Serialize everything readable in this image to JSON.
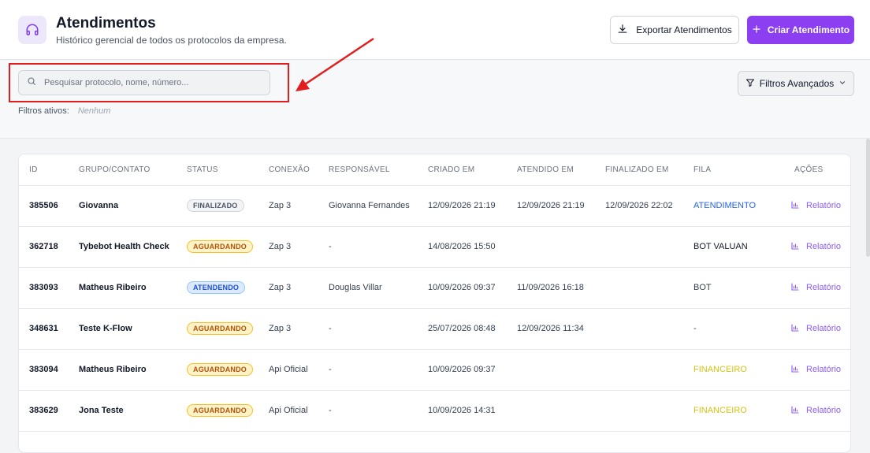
{
  "header": {
    "title": "Atendimentos",
    "subtitle": "Histórico gerencial de todos os protocolos da empresa.",
    "icon": "headset-icon",
    "export_label": "Exportar Atendimentos",
    "create_label": "Criar Atendimento"
  },
  "filters": {
    "search_placeholder": "Pesquisar protocolo, nome, número...",
    "search_value": "",
    "active_label": "Filtros ativos:",
    "active_value": "Nenhum",
    "advanced_label": "Filtros Avançados"
  },
  "colors": {
    "brand": "#8b3ff0",
    "annotation": "#e11d1d"
  },
  "table": {
    "columns": [
      "ID",
      "GRUPO/CONTATO",
      "STATUS",
      "CONEXÃO",
      "RESPONSÁVEL",
      "CRIADO EM",
      "ATENDIDO EM",
      "FINALIZADO EM",
      "FILA",
      "AÇÕES"
    ],
    "rows": [
      {
        "id": "385506",
        "contact": "Giovanna",
        "status": "FINALIZADO",
        "status_kind": "finalizado",
        "connection": "Zap 3",
        "responsible": "Giovanna Fernandes",
        "created": "12/09/2026 21:19",
        "attended": "12/09/2026 21:19",
        "finished": "12/09/2026 22:02",
        "queue": "ATENDIMENTO",
        "queue_color": "#2563eb",
        "action": "Relatório"
      },
      {
        "id": "362718",
        "contact": "Tybebot Health Check",
        "status": "AGUARDANDO",
        "status_kind": "aguardando",
        "connection": "Zap 3",
        "responsible": "-",
        "created": "14/08/2026 15:50",
        "attended": "",
        "finished": "",
        "queue": "BOT VALUAN",
        "queue_color": "#111827",
        "action": "Relatório"
      },
      {
        "id": "383093",
        "contact": "Matheus Ribeiro",
        "status": "ATENDENDO",
        "status_kind": "atendendo",
        "connection": "Zap 3",
        "responsible": "Douglas Villar",
        "created": "10/09/2026 09:37",
        "attended": "11/09/2026 16:18",
        "finished": "",
        "queue": "BOT",
        "queue_color": "#374151",
        "action": "Relatório"
      },
      {
        "id": "348631",
        "contact": "Teste K-Flow",
        "status": "AGUARDANDO",
        "status_kind": "aguardando",
        "connection": "Zap 3",
        "responsible": "-",
        "created": "25/07/2026 08:48",
        "attended": "12/09/2026 11:34",
        "finished": "",
        "queue": "-",
        "queue_color": "#374151",
        "action": "Relatório"
      },
      {
        "id": "383094",
        "contact": "Matheus Ribeiro",
        "status": "AGUARDANDO",
        "status_kind": "aguardando",
        "connection": "Api Oficial",
        "responsible": "-",
        "created": "10/09/2026 09:37",
        "attended": "",
        "finished": "",
        "queue": "FINANCEIRO",
        "queue_color": "#d4c414",
        "action": "Relatório"
      },
      {
        "id": "383629",
        "contact": "Jona Teste",
        "status": "AGUARDANDO",
        "status_kind": "aguardando",
        "connection": "Api Oficial",
        "responsible": "-",
        "created": "10/09/2026 14:31",
        "attended": "",
        "finished": "",
        "queue": "FINANCEIRO",
        "queue_color": "#d4c414",
        "action": "Relatório"
      }
    ]
  }
}
